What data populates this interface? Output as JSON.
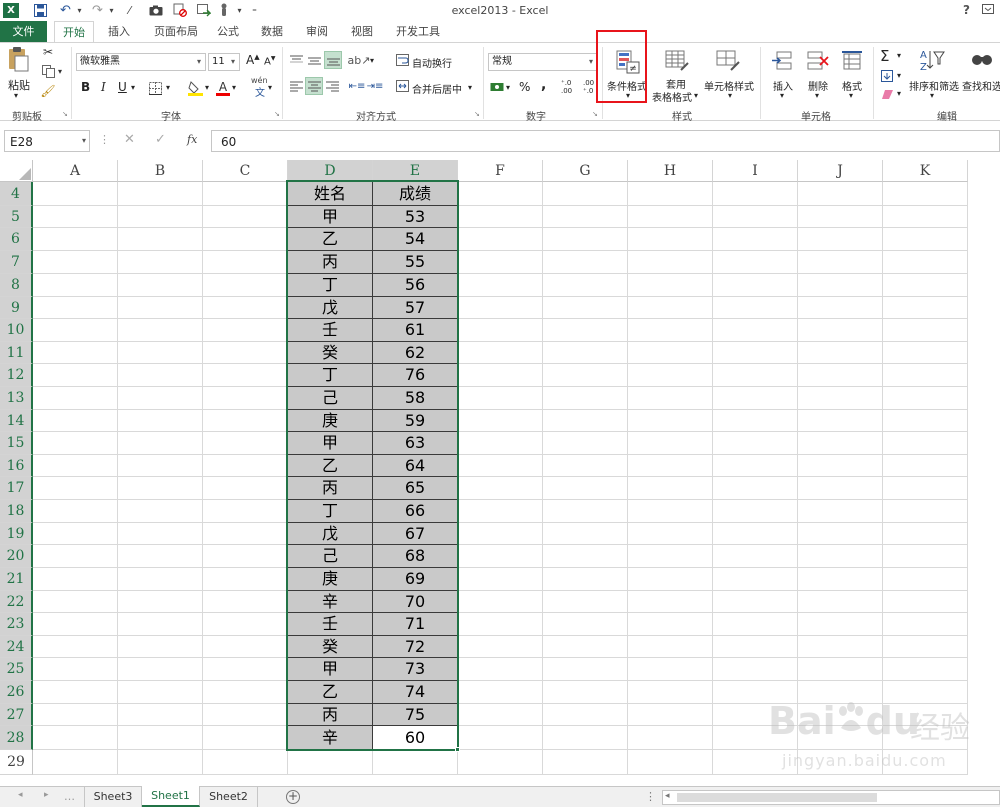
{
  "window": {
    "title": "excel2013 - Excel",
    "help": "?"
  },
  "tabs": [
    "文件",
    "开始",
    "插入",
    "页面布局",
    "公式",
    "数据",
    "审阅",
    "视图",
    "开发工具"
  ],
  "ribbon": {
    "clipboard": {
      "paste": "粘贴",
      "label": "剪贴板"
    },
    "font": {
      "name": "微软雅黑",
      "size": "11",
      "bold": "B",
      "italic": "I",
      "underline": "U",
      "grow": "A",
      "shrink": "A",
      "label": "字体",
      "wen": "wén"
    },
    "alignment": {
      "wrap": "自动换行",
      "merge": "合并后居中",
      "label": "对齐方式"
    },
    "number": {
      "format": "常规",
      "percent": "%",
      "comma": ",",
      "inc": "⁺.0 .00",
      "dec": ".00 ⁺.0",
      "label": "数字"
    },
    "styles": {
      "conditional": "条件格式",
      "table_line1": "套用",
      "table_line2": "表格格式",
      "cell": "单元格样式",
      "label": "样式"
    },
    "cells": {
      "insert": "插入",
      "delete": "删除",
      "format": "格式",
      "label": "单元格"
    },
    "editing": {
      "sort": "排序和筛选",
      "find": "查找和选",
      "label": "编辑",
      "sigma": "Σ"
    },
    "highlight_color": "#e8141b"
  },
  "formula_bar": {
    "name_box": "E28",
    "fx": "fx",
    "value": "60"
  },
  "grid": {
    "columns": [
      "A",
      "B",
      "C",
      "D",
      "E",
      "F",
      "G",
      "H",
      "I",
      "J",
      "K"
    ],
    "rows": [
      "4",
      "5",
      "6",
      "7",
      "8",
      "9",
      "10",
      "11",
      "12",
      "13",
      "14",
      "15",
      "16",
      "17",
      "18",
      "19",
      "20",
      "21",
      "22",
      "23",
      "24",
      "25",
      "26",
      "27",
      "28",
      "29"
    ],
    "header": {
      "name": "姓名",
      "score": "成绩"
    },
    "data": [
      [
        "甲",
        "53"
      ],
      [
        "乙",
        "54"
      ],
      [
        "丙",
        "55"
      ],
      [
        "丁",
        "56"
      ],
      [
        "戊",
        "57"
      ],
      [
        "壬",
        "61"
      ],
      [
        "癸",
        "62"
      ],
      [
        "丁",
        "76"
      ],
      [
        "己",
        "58"
      ],
      [
        "庚",
        "59"
      ],
      [
        "甲",
        "63"
      ],
      [
        "乙",
        "64"
      ],
      [
        "丙",
        "65"
      ],
      [
        "丁",
        "66"
      ],
      [
        "戊",
        "67"
      ],
      [
        "己",
        "68"
      ],
      [
        "庚",
        "69"
      ],
      [
        "辛",
        "70"
      ],
      [
        "壬",
        "71"
      ],
      [
        "癸",
        "72"
      ],
      [
        "甲",
        "73"
      ],
      [
        "乙",
        "74"
      ],
      [
        "丙",
        "75"
      ],
      [
        "辛",
        "60"
      ]
    ]
  },
  "sheets": [
    "Sheet3",
    "Sheet1",
    "Sheet2"
  ],
  "active_sheet": "Sheet1",
  "watermark": {
    "brand": "Bai",
    "brand2": "du",
    "cn": "经验",
    "url": "jingyan.baidu.com"
  }
}
